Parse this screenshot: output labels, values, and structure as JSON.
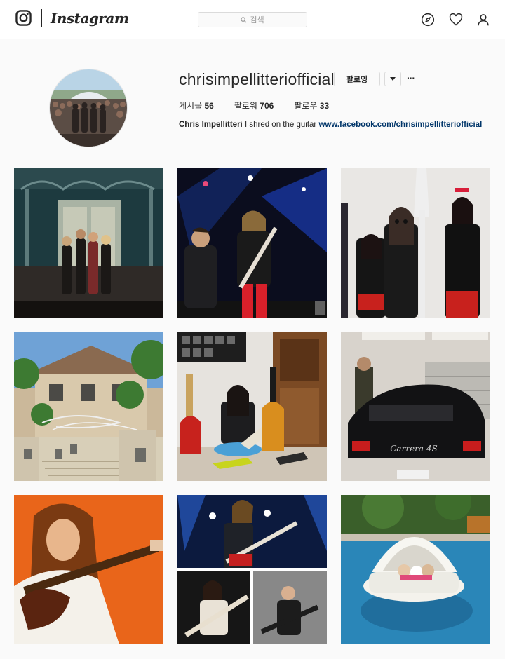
{
  "app": {
    "wordmark": "Instagram",
    "search_placeholder": "검색",
    "icons": [
      "instagram-logo-icon",
      "compass-icon",
      "heart-icon",
      "user-icon",
      "search-icon"
    ]
  },
  "profile": {
    "username": "chrisimpellitteriofficial",
    "follow_label": "팔로잉",
    "more_label": "···",
    "stats": {
      "posts_label": "게시물",
      "posts_value": "56",
      "followers_label": "팔로워",
      "followers_value": "706",
      "following_label": "팔로우",
      "following_value": "33"
    },
    "bio": {
      "name": "Chris Impellitteri",
      "text": "I shred on the guitar",
      "link": "www.facebook.com/chrisimpellitteriofficial"
    }
  },
  "posts": [
    {
      "id": "post-1",
      "description": "band group photo at ornate gate"
    },
    {
      "id": "post-2",
      "description": "two guitarists on stage"
    },
    {
      "id": "post-3",
      "description": "posing with costumed performers"
    },
    {
      "id": "post-4",
      "description": "house with halloween decorations"
    },
    {
      "id": "post-5",
      "description": "seated with guitar collection"
    },
    {
      "id": "post-6",
      "description": "man beside black sports car"
    },
    {
      "id": "post-7",
      "description": "vintage guitarist portrait"
    },
    {
      "id": "post-8",
      "description": "concert photo collage"
    },
    {
      "id": "post-9",
      "description": "dogs on pool float"
    }
  ],
  "car_badge": "Carrera 4S",
  "colors": {
    "link": "#003569",
    "border": "#dbdbdb",
    "background": "#fafafa"
  }
}
